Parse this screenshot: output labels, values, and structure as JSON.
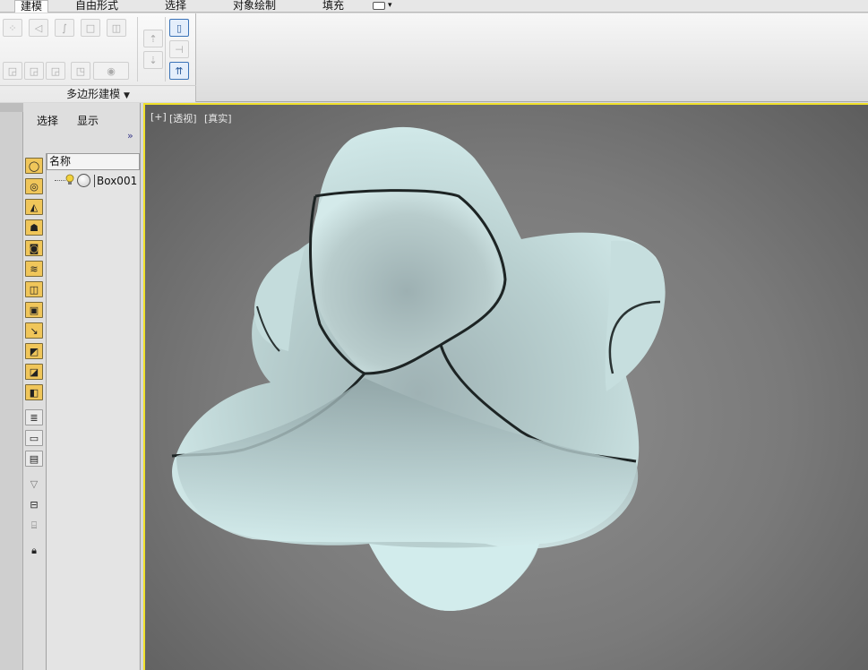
{
  "ribbon": {
    "tabs": [
      "建模",
      "自由形式",
      "选择",
      "对象绘制",
      "填充"
    ],
    "active_tab": "建模",
    "panel_label": "多边形建模",
    "panel_dropdown_glyph": "▼",
    "tab_extra_glyph": "▾"
  },
  "explorer": {
    "menu_select": "选择",
    "menu_display": "显示",
    "expand_glyph": "»",
    "column_name": "名称",
    "objects": [
      {
        "name": "Box001"
      }
    ]
  },
  "viewport": {
    "label_plus": "[+]",
    "label_view": "[透视]",
    "label_shading": "[真实]",
    "border_color": "#f0e02a"
  },
  "icons": {
    "ribbon_left": [
      "vertex-icon",
      "edge-icon",
      "border-icon",
      "polygon-icon",
      "element-icon"
    ],
    "ribbon_left_row2": [
      "edit-poly-icon-1",
      "edit-poly-icon-2",
      "edit-poly-icon-3",
      "edit-poly-icon-4",
      "circle-icon"
    ],
    "explorer_tools": [
      "display-all-icon",
      "geometry-icon",
      "shapes-icon",
      "lights-icon",
      "cameras-icon",
      "helpers-icon",
      "space-warps-icon",
      "groups-icon",
      "xrefs-icon",
      "bones-icon",
      "containers-icon",
      "frozen-icon",
      "hidden-icon",
      "list-icon",
      "box-icon",
      "properties-icon",
      "filter-icon",
      "filter-selected-icon",
      "display-children-icon",
      "lock-icon"
    ]
  }
}
